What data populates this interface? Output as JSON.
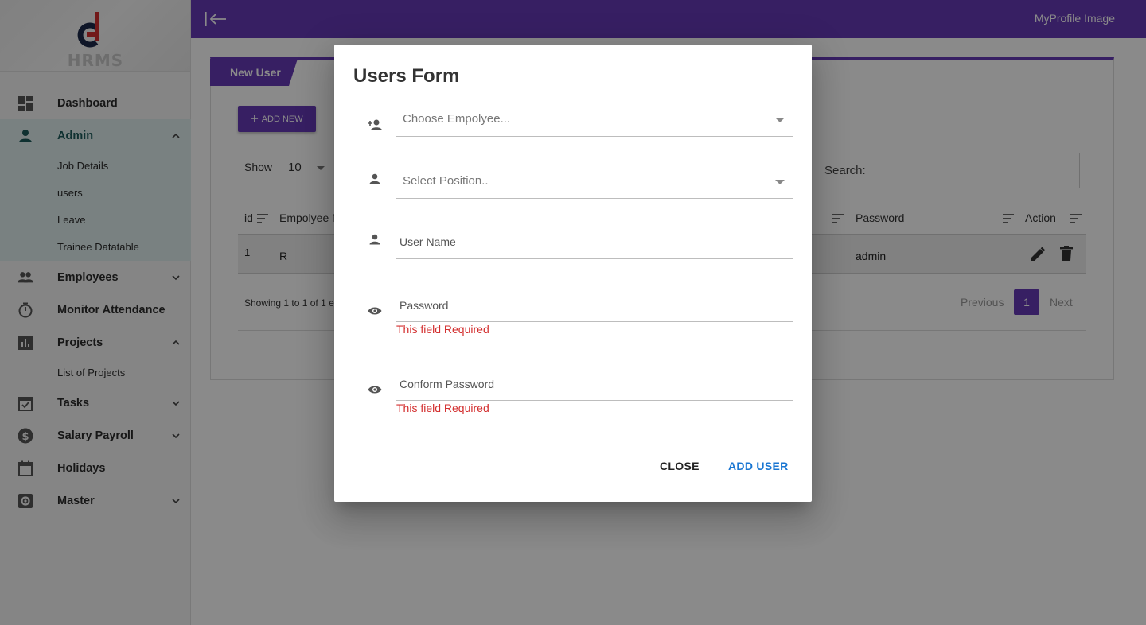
{
  "app": {
    "logo_text": "HRMS",
    "colors": {
      "primary": "#673ab7",
      "active_bg": "#e0efef",
      "error": "#d32f2f",
      "link_blue": "#1976d2"
    }
  },
  "sidebar": {
    "items": [
      {
        "label": "Dashboard",
        "icon": "dashboard-icon"
      },
      {
        "label": "Admin",
        "icon": "person-icon",
        "expanded": true,
        "children": [
          "Job Details",
          "users",
          "Leave",
          "Trainee Datatable"
        ]
      },
      {
        "label": "Employees",
        "icon": "people-icon"
      },
      {
        "label": "Monitor Attendance",
        "icon": "timer-icon"
      },
      {
        "label": "Projects",
        "icon": "bar-chart-icon",
        "expanded": true,
        "children": [
          "List of Projects"
        ]
      },
      {
        "label": "Tasks",
        "icon": "event-available-icon"
      },
      {
        "label": "Salary Payroll",
        "icon": "dollar-icon"
      },
      {
        "label": "Holidays",
        "icon": "calendar-icon"
      },
      {
        "label": "Master",
        "icon": "settings-icon"
      }
    ]
  },
  "topbar": {
    "profile_label": "MyProfile Image"
  },
  "card": {
    "tab_label": "New User",
    "add_new_label": "ADD NEW",
    "show_label": "Show",
    "show_value": "10",
    "search_placeholder": "Search:",
    "columns": {
      "id": "id",
      "employee": "Empolyee N",
      "password": "Password",
      "action": "Action"
    },
    "rows": [
      {
        "id": "1",
        "employee": "R",
        "password": "admin"
      }
    ],
    "info_text": "Showing 1 to 1 of 1 e",
    "pager": {
      "previous": "Previous",
      "page": "1",
      "next": "Next"
    }
  },
  "dialog": {
    "title": "Users Form",
    "employee_placeholder": "Choose Empolyee...",
    "position_placeholder": "Select Position..",
    "username_label": "User Name",
    "password_label": "Password",
    "password_error": "This field Required",
    "confirm_label": "Conform Password",
    "confirm_error": "This field Required",
    "close_label": "CLOSE",
    "submit_label": "ADD USER"
  }
}
